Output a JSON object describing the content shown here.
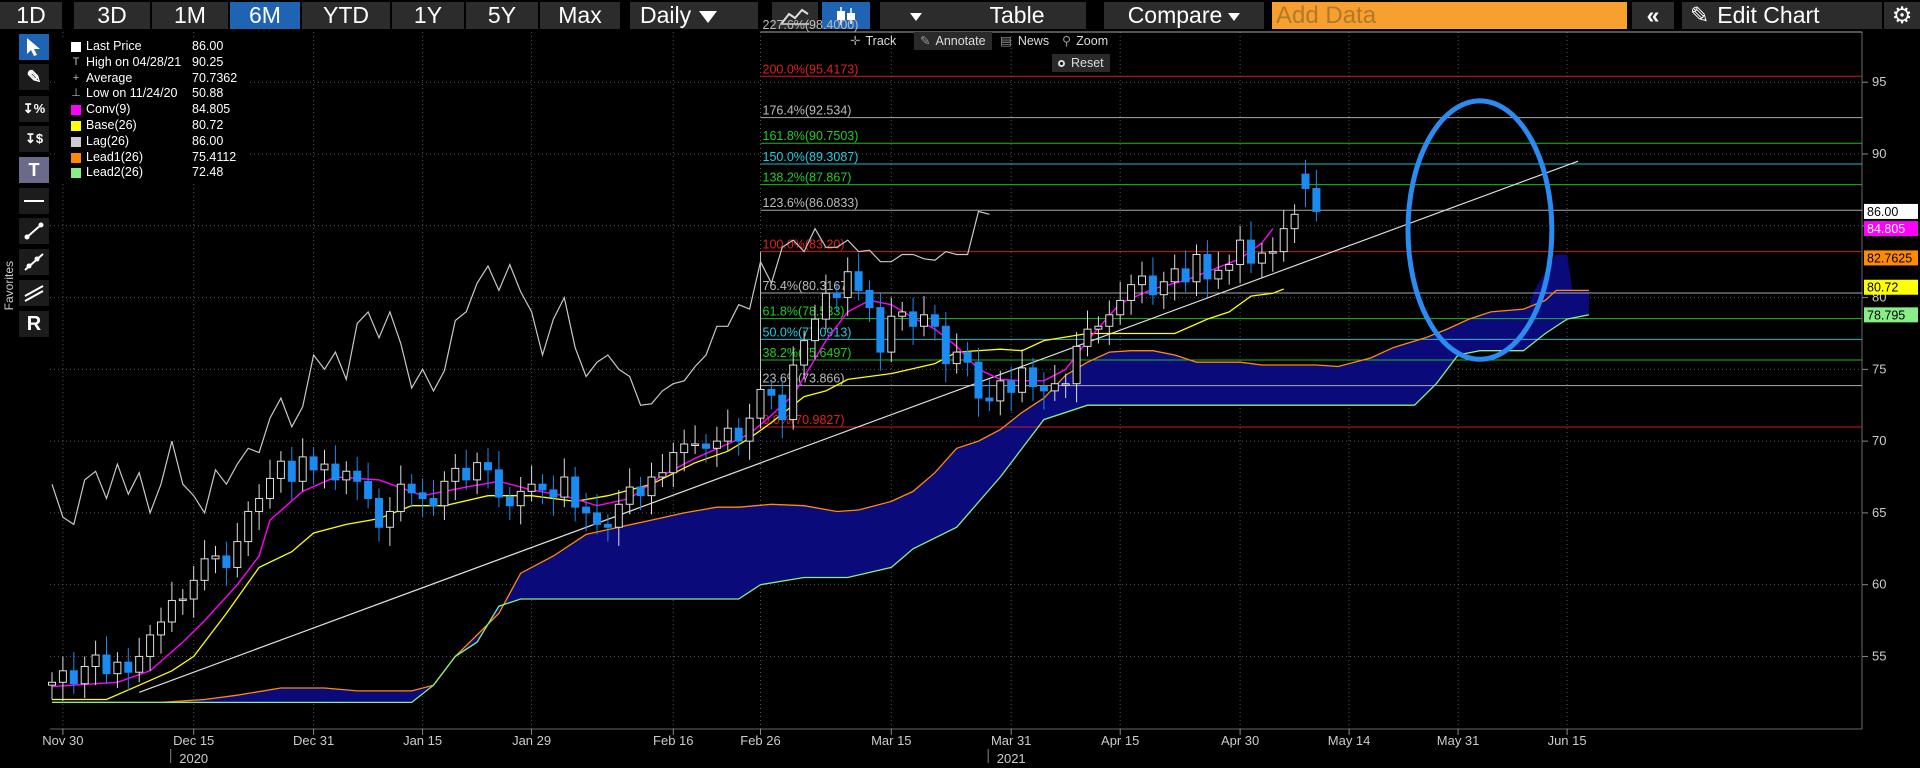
{
  "toolbar": {
    "periods": [
      "1D",
      "3D",
      "1M",
      "6M",
      "YTD",
      "1Y",
      "5Y",
      "Max"
    ],
    "active_period": "6M",
    "interval": "Daily",
    "table_label": "Table",
    "compare_label": "Compare",
    "add_data_placeholder": "Add Data",
    "edit_chart_label": "Edit Chart"
  },
  "sidebar": {
    "favorites_label": "Favorites",
    "tools": [
      "cursor",
      "pen",
      "percent",
      "dollar",
      "text",
      "line",
      "segment",
      "ray",
      "channel",
      "R"
    ]
  },
  "chart_tools": {
    "track_label": "Track",
    "annotate_label": "Annotate",
    "news_label": "News",
    "zoom_label": "Zoom",
    "reset_label": "Reset"
  },
  "legend": [
    {
      "label": "Last Price",
      "value": "86.00",
      "color": "#ffffff",
      "symbol": "box"
    },
    {
      "label": "High on 04/28/21",
      "value": "90.25",
      "color": "#bbbbbb",
      "symbol": "T"
    },
    {
      "label": "Average",
      "value": "70.7362",
      "color": "#bbbbbb",
      "symbol": "+"
    },
    {
      "label": "Low on 11/24/20",
      "value": "50.88",
      "color": "#bbbbbb",
      "symbol": "⊥"
    },
    {
      "label": "Conv(9)",
      "value": "84.805",
      "color": "#ff00ff",
      "symbol": "box"
    },
    {
      "label": "Base(26)",
      "value": "80.72",
      "color": "#ffff00",
      "symbol": "box"
    },
    {
      "label": "Lag(26)",
      "value": "86.00",
      "color": "#cccccc",
      "symbol": "box"
    },
    {
      "label": "Lead1(26)",
      "value": "75.4112",
      "color": "#ff8c00",
      "symbol": "box"
    },
    {
      "label": "Lead2(26)",
      "value": "72.48",
      "color": "#88ee88",
      "symbol": "box"
    }
  ],
  "colors": {
    "up_candle": "#ffffff",
    "down_candle": "#1a8bf0",
    "conv": "#ff00ff",
    "base": "#ffff00",
    "lag": "#c8c8c8",
    "lead1": "#ff8c00",
    "lead2": "#88ee88",
    "cloud": "#0a0a7a",
    "fib_red": "#e02020",
    "fib_green": "#22cc22",
    "fib_cyan": "#22ccdd",
    "fib_gray": "#bbbbbb",
    "circle": "#2a8cf0",
    "trend": "#dddddd"
  },
  "chart_data": {
    "type": "candlestick",
    "x_range": [
      0,
      141
    ],
    "ylim": [
      51.5,
      98.5
    ],
    "y_ticks": [
      55,
      60,
      65,
      70,
      75,
      80,
      85,
      90,
      95
    ],
    "x_ticks": [
      {
        "t": 1,
        "label": "Nov 30"
      },
      {
        "t": 13,
        "label": "Dec 15"
      },
      {
        "t": 24,
        "label": "Dec 31"
      },
      {
        "t": 34,
        "label": "Jan 15"
      },
      {
        "t": 44,
        "label": "Jan 29"
      },
      {
        "t": 57,
        "label": "Feb 16"
      },
      {
        "t": 65,
        "label": "Feb 26"
      },
      {
        "t": 77,
        "label": "Mar 15"
      },
      {
        "t": 88,
        "label": "Mar 31"
      },
      {
        "t": 98,
        "label": "Apr 15"
      },
      {
        "t": 109,
        "label": "Apr 30"
      },
      {
        "t": 119,
        "label": "May 14"
      },
      {
        "t": 129,
        "label": "May 31"
      },
      {
        "t": 139,
        "label": "Jun 15"
      }
    ],
    "year_labels": [
      {
        "t": 13,
        "label": "2020"
      },
      {
        "t": 88,
        "label": "2021"
      }
    ],
    "closes": [
      53.2,
      54.0,
      53.1,
      54.3,
      55.1,
      53.8,
      54.6,
      53.9,
      55.0,
      56.5,
      57.4,
      58.9,
      59.0,
      60.3,
      61.8,
      62.0,
      61.2,
      63.0,
      65.1,
      66.0,
      67.4,
      68.6,
      67.2,
      68.9,
      68.0,
      68.4,
      67.3,
      67.9,
      67.2,
      66.0,
      64.0,
      65.1,
      67.0,
      66.4,
      66.0,
      65.5,
      67.2,
      68.1,
      67.3,
      68.5,
      68.0,
      66.1,
      65.5,
      66.5,
      67.0,
      66.6,
      66.1,
      67.5,
      65.4,
      65.0,
      64.2,
      64.0,
      65.6,
      66.8,
      66.2,
      67.5,
      67.8,
      69.2,
      69.8,
      69.8,
      69.5,
      70.0,
      70.9,
      70.0,
      71.6,
      73.6,
      73.2,
      71.5,
      75.3,
      77.0,
      78.5,
      80.3,
      80.0,
      81.8,
      80.5,
      79.3,
      76.2,
      78.7,
      79.0,
      78.0,
      78.8,
      78.0,
      75.4,
      76.2,
      75.5,
      73.0,
      72.8,
      74.2,
      73.4,
      75.1,
      73.8,
      73.5,
      74.0,
      74.0,
      76.6,
      77.8,
      78.0,
      78.8,
      79.8,
      80.9,
      81.5,
      80.2,
      81.1,
      82.0,
      81.1,
      83.0,
      81.3,
      81.9,
      82.3,
      84.0,
      82.4,
      83.1,
      83.2,
      84.8,
      85.8,
      87.6,
      86.0
    ],
    "opens": [
      53.0,
      53.2,
      54.0,
      53.1,
      54.3,
      55.1,
      53.8,
      54.6,
      53.9,
      55.0,
      56.5,
      57.4,
      58.9,
      59.0,
      60.3,
      61.8,
      62.0,
      61.2,
      63.0,
      65.1,
      66.0,
      67.4,
      68.6,
      67.2,
      68.9,
      68.0,
      68.4,
      67.3,
      67.9,
      67.2,
      66.0,
      64.0,
      65.1,
      67.0,
      66.4,
      66.0,
      65.5,
      67.2,
      68.1,
      67.3,
      68.5,
      68.0,
      66.1,
      65.5,
      66.5,
      67.0,
      66.6,
      66.1,
      67.5,
      65.4,
      65.0,
      64.2,
      64.0,
      65.6,
      66.8,
      66.2,
      67.5,
      67.8,
      69.2,
      69.8,
      69.8,
      69.5,
      70.0,
      70.9,
      70.0,
      71.6,
      73.6,
      73.2,
      71.5,
      75.3,
      77.0,
      78.5,
      80.3,
      80.0,
      81.8,
      80.5,
      79.3,
      76.2,
      78.7,
      79.0,
      78.0,
      78.8,
      78.0,
      75.4,
      76.2,
      75.5,
      73.0,
      72.8,
      74.2,
      73.4,
      75.1,
      73.8,
      73.5,
      74.0,
      74.0,
      76.6,
      77.8,
      78.0,
      78.8,
      79.8,
      80.9,
      81.5,
      80.2,
      81.1,
      82.0,
      81.1,
      83.0,
      81.3,
      81.9,
      82.3,
      84.0,
      82.4,
      83.1,
      83.2,
      84.8,
      88.6,
      87.6
    ],
    "conv": [
      [
        0,
        52.9
      ],
      [
        6,
        53.2
      ],
      [
        9,
        54.0
      ],
      [
        12,
        56.0
      ],
      [
        14,
        57.5
      ],
      [
        17,
        60.0
      ],
      [
        19,
        62.0
      ],
      [
        20,
        64.5
      ],
      [
        23,
        66.5
      ],
      [
        26,
        67.5
      ],
      [
        30,
        67.3
      ],
      [
        34,
        66.2
      ],
      [
        38,
        66.8
      ],
      [
        41,
        67.2
      ],
      [
        44,
        66.6
      ],
      [
        47,
        66.2
      ],
      [
        50,
        65.5
      ],
      [
        53,
        66.0
      ],
      [
        56,
        67.6
      ],
      [
        59,
        68.8
      ],
      [
        62,
        69.8
      ],
      [
        64,
        70.5
      ],
      [
        66,
        71.8
      ],
      [
        68,
        73.2
      ],
      [
        71,
        77.0
      ],
      [
        73,
        79.0
      ],
      [
        75,
        79.8
      ],
      [
        77,
        79.5
      ],
      [
        79,
        78.6
      ],
      [
        81,
        77.8
      ],
      [
        83,
        76.6
      ],
      [
        85,
        75.0
      ],
      [
        87,
        74.3
      ],
      [
        89,
        74.2
      ],
      [
        91,
        74.2
      ],
      [
        93,
        75.0
      ],
      [
        95,
        77.0
      ],
      [
        98,
        79.6
      ],
      [
        101,
        80.6
      ],
      [
        104,
        81.2
      ],
      [
        107,
        82.1
      ],
      [
        109,
        82.7
      ],
      [
        111,
        83.8
      ],
      [
        112,
        84.8
      ]
    ],
    "base": [
      [
        0,
        52.0
      ],
      [
        5,
        52.0
      ],
      [
        8,
        53.0
      ],
      [
        11,
        54.0
      ],
      [
        13,
        55.0
      ],
      [
        16,
        58.0
      ],
      [
        19,
        61.2
      ],
      [
        22,
        62.3
      ],
      [
        24,
        63.6
      ],
      [
        27,
        64.2
      ],
      [
        30,
        64.6
      ],
      [
        33,
        65.5
      ],
      [
        36,
        65.5
      ],
      [
        40,
        66.2
      ],
      [
        44,
        66.2
      ],
      [
        48,
        65.8
      ],
      [
        51,
        66.2
      ],
      [
        55,
        67.0
      ],
      [
        59,
        68.5
      ],
      [
        62,
        69.3
      ],
      [
        64,
        70.2
      ],
      [
        66,
        71.3
      ],
      [
        69,
        73.1
      ],
      [
        71,
        73.5
      ],
      [
        73,
        74.3
      ],
      [
        77,
        74.7
      ],
      [
        81,
        75.4
      ],
      [
        83,
        76.2
      ],
      [
        87,
        76.4
      ],
      [
        89,
        76.3
      ],
      [
        91,
        77.0
      ],
      [
        95,
        77.5
      ],
      [
        99,
        77.5
      ],
      [
        103,
        77.5
      ],
      [
        106,
        78.5
      ],
      [
        108,
        79.0
      ],
      [
        110,
        80.1
      ],
      [
        112,
        80.3
      ],
      [
        113,
        80.6
      ]
    ],
    "lag": [
      [
        0,
        67.0
      ],
      [
        1,
        64.7
      ],
      [
        2,
        64.2
      ],
      [
        3,
        67.3
      ],
      [
        4,
        67.9
      ],
      [
        5,
        66.0
      ],
      [
        6,
        68.4
      ],
      [
        7,
        66.3
      ],
      [
        8,
        67.8
      ],
      [
        9,
        65.0
      ],
      [
        10,
        67.0
      ],
      [
        11,
        70.0
      ],
      [
        12,
        67.0
      ],
      [
        13,
        66.2
      ],
      [
        14,
        65.0
      ],
      [
        15,
        68.0
      ],
      [
        16,
        67.0
      ],
      [
        17,
        68.4
      ],
      [
        18,
        69.5
      ],
      [
        19,
        69.2
      ],
      [
        20,
        71.6
      ],
      [
        21,
        73.0
      ],
      [
        22,
        71.0
      ],
      [
        23,
        72.4
      ],
      [
        24,
        76.0
      ],
      [
        25,
        75.0
      ],
      [
        26,
        76.2
      ],
      [
        27,
        74.3
      ],
      [
        28,
        78.2
      ],
      [
        29,
        79.0
      ],
      [
        30,
        77.2
      ],
      [
        31,
        79.0
      ],
      [
        32,
        76.8
      ],
      [
        33,
        73.7
      ],
      [
        34,
        75.0
      ],
      [
        35,
        73.5
      ],
      [
        36,
        74.9
      ],
      [
        37,
        78.4
      ],
      [
        38,
        79.0
      ],
      [
        39,
        81.0
      ],
      [
        40,
        82.2
      ],
      [
        41,
        80.5
      ],
      [
        42,
        82.3
      ],
      [
        43,
        80.4
      ],
      [
        44,
        79.0
      ],
      [
        45,
        76.0
      ],
      [
        46,
        78.5
      ],
      [
        47,
        80.0
      ],
      [
        48,
        76.5
      ],
      [
        49,
        74.5
      ],
      [
        50,
        75.5
      ],
      [
        51,
        76.0
      ],
      [
        52,
        75.0
      ],
      [
        53,
        74.5
      ],
      [
        54,
        72.5
      ],
      [
        55,
        72.6
      ],
      [
        56,
        73.5
      ],
      [
        57,
        74.0
      ],
      [
        58,
        74.2
      ],
      [
        59,
        75.2
      ],
      [
        60,
        76.0
      ],
      [
        61,
        78.0
      ],
      [
        62,
        78.0
      ],
      [
        63,
        79.5
      ],
      [
        64,
        79.2
      ],
      [
        65,
        82.5
      ],
      [
        66,
        81.0
      ],
      [
        67,
        83.5
      ],
      [
        68,
        84.0
      ],
      [
        69,
        83.2
      ],
      [
        70,
        84.8
      ],
      [
        71,
        83.5
      ],
      [
        72,
        83.5
      ],
      [
        73,
        84.0
      ],
      [
        74,
        83.2
      ],
      [
        75,
        83.3
      ],
      [
        76,
        82.5
      ],
      [
        77,
        82.5
      ],
      [
        78,
        83.0
      ],
      [
        79,
        83.0
      ],
      [
        80,
        82.7
      ],
      [
        81,
        82.6
      ],
      [
        82,
        83.2
      ],
      [
        83,
        83.0
      ],
      [
        84,
        83.0
      ],
      [
        85,
        86.0
      ],
      [
        86,
        85.8
      ]
    ],
    "lead1": [
      [
        0,
        51.8
      ],
      [
        7,
        51.8
      ],
      [
        10,
        51.8
      ],
      [
        14,
        52.0
      ],
      [
        17,
        52.3
      ],
      [
        21,
        52.8
      ],
      [
        25,
        52.8
      ],
      [
        28,
        52.6
      ],
      [
        33,
        52.6
      ],
      [
        35,
        53.0
      ],
      [
        37,
        55.0
      ],
      [
        39,
        56.5
      ],
      [
        41,
        58.0
      ],
      [
        43,
        60.8
      ],
      [
        46,
        62.0
      ],
      [
        49,
        63.5
      ],
      [
        52,
        64.0
      ],
      [
        55,
        64.5
      ],
      [
        58,
        65.0
      ],
      [
        61,
        65.4
      ],
      [
        63,
        65.4
      ],
      [
        66,
        65.6
      ],
      [
        69,
        65.5
      ],
      [
        72,
        65.1
      ],
      [
        74,
        65.2
      ],
      [
        77,
        65.8
      ],
      [
        79,
        66.5
      ],
      [
        81,
        67.8
      ],
      [
        83,
        69.5
      ],
      [
        85,
        70.0
      ],
      [
        87,
        70.8
      ],
      [
        89,
        72.0
      ],
      [
        91,
        73.0
      ],
      [
        93,
        74.6
      ],
      [
        95,
        75.5
      ],
      [
        97,
        76.2
      ],
      [
        99,
        76.3
      ],
      [
        101,
        76.3
      ],
      [
        103,
        76.0
      ],
      [
        105,
        75.5
      ],
      [
        107,
        75.5
      ],
      [
        109,
        75.5
      ],
      [
        111,
        75.3
      ],
      [
        113,
        75.3
      ],
      [
        116,
        75.3
      ],
      [
        118,
        75.2
      ],
      [
        121,
        75.8
      ],
      [
        123,
        76.5
      ],
      [
        126,
        77.2
      ],
      [
        128,
        77.8
      ],
      [
        130,
        78.5
      ],
      [
        132,
        79.0
      ],
      [
        135,
        79.2
      ],
      [
        137,
        79.8
      ],
      [
        138,
        80.5
      ],
      [
        140,
        80.5
      ],
      [
        141,
        80.5
      ]
    ],
    "lead2": [
      [
        0,
        51.8
      ],
      [
        25,
        51.8
      ],
      [
        33,
        51.8
      ],
      [
        35,
        53.0
      ],
      [
        37,
        55.0
      ],
      [
        39,
        56.0
      ],
      [
        41,
        58.5
      ],
      [
        43,
        59.0
      ],
      [
        63,
        59.0
      ],
      [
        65,
        60.0
      ],
      [
        69,
        60.5
      ],
      [
        73,
        60.5
      ],
      [
        77,
        61.2
      ],
      [
        79,
        62.5
      ],
      [
        83,
        64.0
      ],
      [
        87,
        67.5
      ],
      [
        91,
        71.5
      ],
      [
        95,
        72.5
      ],
      [
        105,
        72.5
      ],
      [
        115,
        72.5
      ],
      [
        125,
        72.5
      ],
      [
        127,
        74.0
      ],
      [
        129,
        76.0
      ],
      [
        131,
        76.3
      ],
      [
        135,
        76.3
      ],
      [
        137,
        77.5
      ],
      [
        139,
        78.5
      ],
      [
        141,
        78.8
      ]
    ],
    "cloud_extra_peak": [
      [
        136,
        80.5
      ],
      [
        138,
        83.0
      ],
      [
        139,
        83.0
      ]
    ],
    "fib_levels": [
      {
        "ratio": "227.6%",
        "value": 98.5,
        "label": "227.6%(98.4000)",
        "color": "gray"
      },
      {
        "ratio": "200.0%",
        "value": 95.4173,
        "label": "200.0%(95.4173)",
        "color": "red"
      },
      {
        "ratio": "176.4%",
        "value": 92.534,
        "label": "176.4%(92.534)",
        "color": "gray"
      },
      {
        "ratio": "161.8%",
        "value": 90.7503,
        "label": "161.8%(90.7503)",
        "color": "green"
      },
      {
        "ratio": "150.0%",
        "value": 89.3087,
        "label": "150.0%(89.3087)",
        "color": "cyan"
      },
      {
        "ratio": "138.2%",
        "value": 87.867,
        "label": "138.2%(87.867)",
        "color": "green"
      },
      {
        "ratio": "123.6%",
        "value": 86.0833,
        "label": "123.6%(86.0833)",
        "color": "gray"
      },
      {
        "ratio": "100.0%",
        "value": 83.2,
        "label": "100.0%(83.20)",
        "color": "red"
      },
      {
        "ratio": "76.4%",
        "value": 80.3167,
        "label": "76.4%(80.3167)",
        "color": "gray"
      },
      {
        "ratio": "61.8%",
        "value": 78.533,
        "label": "61.8%(78.533)",
        "color": "green"
      },
      {
        "ratio": "50.0%",
        "value": 77.0913,
        "label": "50.0%(77.0913)",
        "color": "cyan"
      },
      {
        "ratio": "38.2%",
        "value": 75.6497,
        "label": "38.2%(75.6497)",
        "color": "green"
      },
      {
        "ratio": "23.6%",
        "value": 73.866,
        "label": "23.6%(73.866)",
        "color": "gray"
      },
      {
        "ratio": "0.0%",
        "value": 70.9827,
        "label": "0.0%(70.9827)",
        "color": "red"
      }
    ],
    "fib_start_t": 65,
    "trendline": [
      [
        8,
        52.5
      ],
      [
        140,
        89.5
      ]
    ],
    "circle": {
      "t": 131,
      "y": 84.7,
      "rx_t": 6.6,
      "ry_y": 9.0
    },
    "right_labels": [
      {
        "value": 86.0,
        "text": "86.00",
        "bg": "#ffffff",
        "fg": "#000000"
      },
      {
        "value": 84.805,
        "text": "84.805",
        "bg": "#ff00ff",
        "fg": "#ffffff"
      },
      {
        "value": 82.7625,
        "text": "82.7625",
        "bg": "#ff8c00",
        "fg": "#000000"
      },
      {
        "value": 80.72,
        "text": "80.72",
        "bg": "#ffff00",
        "fg": "#000000"
      },
      {
        "value": 78.795,
        "text": "78.795",
        "bg": "#88ee88",
        "fg": "#000000"
      }
    ]
  }
}
